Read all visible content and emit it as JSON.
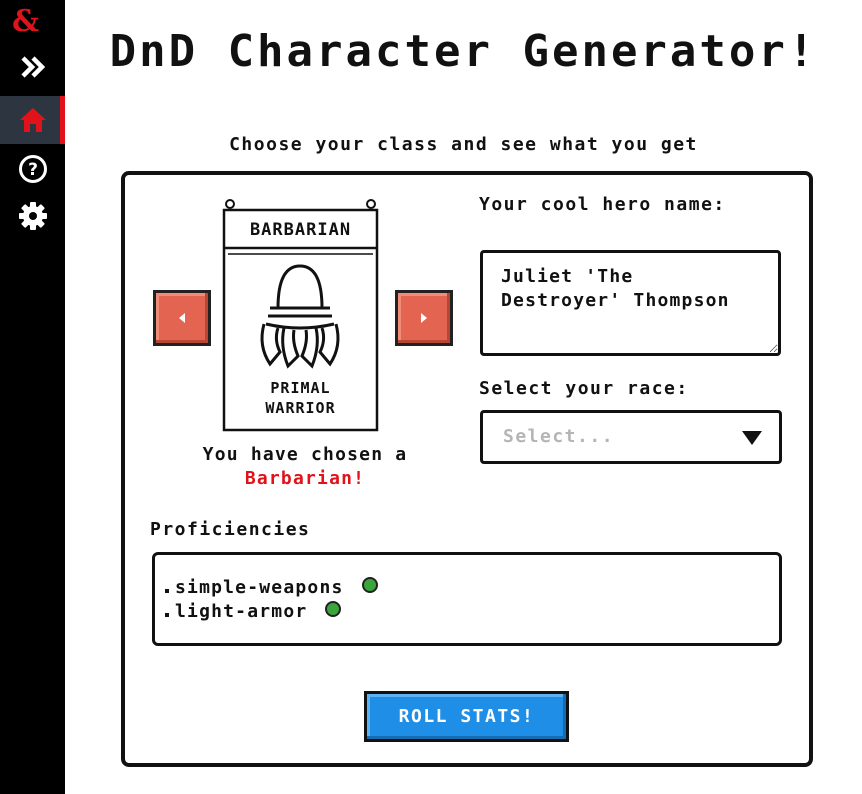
{
  "sidebar": {
    "items": [
      {
        "name": "dnd-logo-icon"
      },
      {
        "name": "expand-icon"
      },
      {
        "name": "home-icon",
        "active": true
      },
      {
        "name": "help-icon"
      },
      {
        "name": "settings-icon"
      }
    ],
    "accent": "#e0121a"
  },
  "header": {
    "title": "DnD Character Generator!",
    "subtitle": "Choose your class and see what you get"
  },
  "class_picker": {
    "banner_title": "BARBARIAN",
    "banner_subtitle_line1": "PRIMAL",
    "banner_subtitle_line2": "WARRIOR",
    "chosen_prefix": "You have chosen a",
    "chosen_class": "Barbarian!",
    "prev_icon": "chevron-left-icon",
    "next_icon": "chevron-right-icon"
  },
  "hero_name": {
    "label": "Your cool hero name:",
    "value": "Juliet 'The Destroyer' Thompson"
  },
  "race": {
    "label": "Select your race:",
    "placeholder": "Select..."
  },
  "proficiencies": {
    "label": "Proficiencies",
    "items": [
      "simple-weapons",
      "light-armor"
    ]
  },
  "actions": {
    "roll_label": "ROLL STATS!"
  },
  "colors": {
    "arrow_button": "#e36450",
    "roll_button": "#1f8ee6",
    "highlight": "#e0121a",
    "status_dot": "#3aa53a"
  }
}
